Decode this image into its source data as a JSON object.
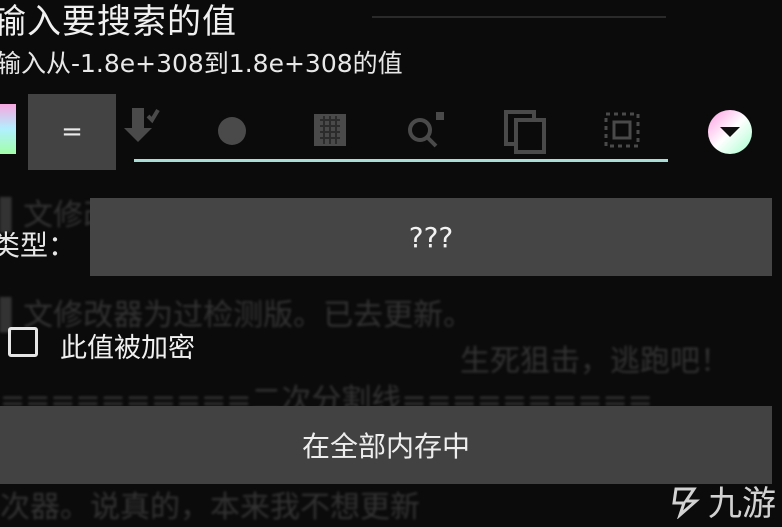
{
  "dialog": {
    "title": "输入要搜索的值",
    "subtitle": "输入从-1.8e+308到1.8e+308的值"
  },
  "toolbar": {
    "operator_label": "=",
    "icons": [
      "paste-icon",
      "record-icon",
      "keyboard-icon",
      "search-history-icon",
      "copy-icon",
      "select-icon",
      "chevron-down-icon"
    ]
  },
  "type_row": {
    "label": "类型：",
    "value": "???"
  },
  "encrypted": {
    "label": "此值被加密",
    "checked": false
  },
  "search_scope_button": "在全部内存中",
  "watermark": {
    "text": "九游"
  },
  "colors": {
    "accent_line": "#a9ded7",
    "button_bg": "#434343",
    "background": "#0b0b0b"
  }
}
